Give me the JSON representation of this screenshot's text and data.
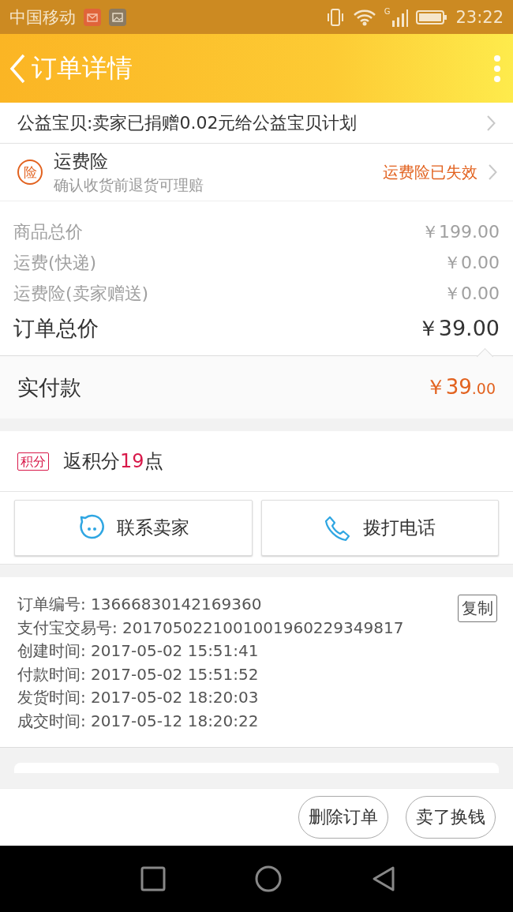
{
  "status_bar": {
    "carrier": "中国移动",
    "network": "G",
    "time": "23:22"
  },
  "header": {
    "title": "订单详情"
  },
  "charity": {
    "text": "公益宝贝:卖家已捐赠0.02元给公益宝贝计划"
  },
  "insurance": {
    "badge": "险",
    "title": "运费险",
    "subtitle": "确认收货前退货可理赔",
    "status": "运费险已失效"
  },
  "price_rows": [
    {
      "label": "商品总价",
      "value": "￥199.00",
      "kind": "minor"
    },
    {
      "label": "运费(快递)",
      "value": "￥0.00",
      "kind": "minor"
    },
    {
      "label": "运费险(卖家赠送)",
      "value": "￥0.00",
      "kind": "minor"
    },
    {
      "label": "订单总价",
      "value": "￥39.00",
      "kind": "total"
    }
  ],
  "paid": {
    "label": "实付款",
    "amount": "￥39",
    "decimal": ".00"
  },
  "points": {
    "badge": "积分",
    "prefix": "返积分",
    "value": "19",
    "suffix": "点"
  },
  "contact_buttons": [
    {
      "label": "联系卖家",
      "kind": "chat"
    },
    {
      "label": "拨打电话",
      "kind": "phone"
    }
  ],
  "order_info": {
    "copy_button": "复制",
    "rows": [
      "订单编号: 13666830142169360",
      "支付宝交易号: 2017050221001001960229349817",
      "创建时间: 2017-05-02 15:51:41",
      "付款时间: 2017-05-02 15:51:52",
      "发货时间: 2017-05-02 18:20:03",
      "成交时间: 2017-05-12 18:20:22"
    ]
  },
  "actions": [
    "删除订单",
    "卖了换钱"
  ]
}
